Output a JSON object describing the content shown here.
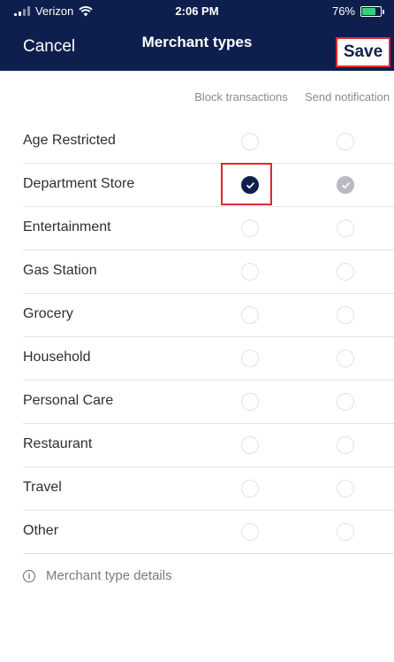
{
  "status_bar": {
    "carrier": "Verizon",
    "time": "2:06 PM",
    "battery": "76%",
    "battery_level": 0.76
  },
  "nav": {
    "cancel_label": "Cancel",
    "title": "Merchant types",
    "save_label": "Save"
  },
  "columns": {
    "block": "Block transactions",
    "notify": "Send notification"
  },
  "rows": [
    {
      "label": "Age Restricted",
      "block": false,
      "notify": false
    },
    {
      "label": "Department Store",
      "block": true,
      "notify": true
    },
    {
      "label": "Entertainment",
      "block": false,
      "notify": false
    },
    {
      "label": "Gas Station",
      "block": false,
      "notify": false
    },
    {
      "label": "Grocery",
      "block": false,
      "notify": false
    },
    {
      "label": "Household",
      "block": false,
      "notify": false
    },
    {
      "label": "Personal Care",
      "block": false,
      "notify": false
    },
    {
      "label": "Restaurant",
      "block": false,
      "notify": false
    },
    {
      "label": "Travel",
      "block": false,
      "notify": false
    },
    {
      "label": "Other",
      "block": false,
      "notify": false
    }
  ],
  "footer": {
    "info_icon": "info-circle-icon",
    "details_label": "Merchant type details"
  },
  "colors": {
    "header_bg": "#0f1f4d",
    "highlight": "#e3262e",
    "check_gray": "#b8b8c6"
  }
}
